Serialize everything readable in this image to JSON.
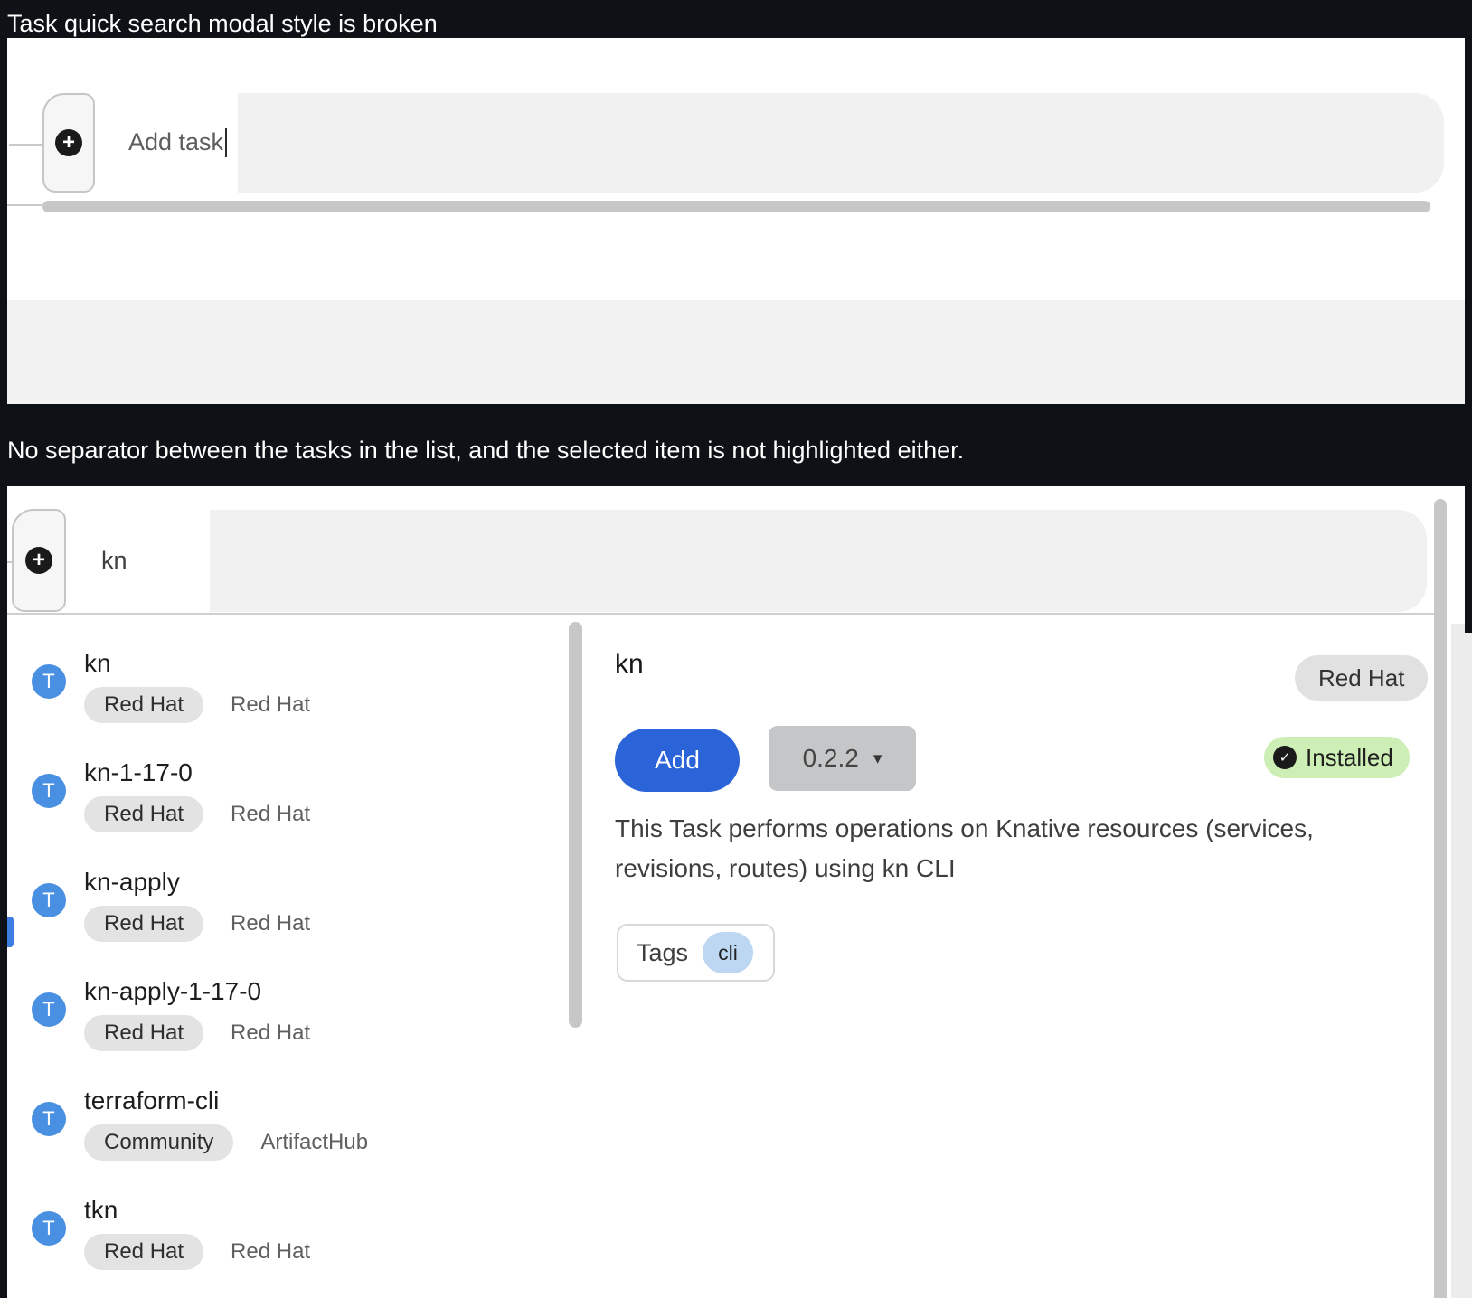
{
  "captions": {
    "first": "Task quick search modal style is broken",
    "second": "No separator between the tasks in the list, and the selected item is not highlighted either."
  },
  "icons": {
    "plus": "+",
    "check": "✓",
    "caret_down": "▾",
    "avatar_letter": "T"
  },
  "panel1": {
    "search_placeholder": "Add task"
  },
  "panel2": {
    "search_value": "kn",
    "list": [
      {
        "initial": "T",
        "name": "kn",
        "badge": "Red Hat",
        "source": "Red Hat"
      },
      {
        "initial": "T",
        "name": "kn-1-17-0",
        "badge": "Red Hat",
        "source": "Red Hat"
      },
      {
        "initial": "T",
        "name": "kn-apply",
        "badge": "Red Hat",
        "source": "Red Hat"
      },
      {
        "initial": "T",
        "name": "kn-apply-1-17-0",
        "badge": "Red Hat",
        "source": "Red Hat"
      },
      {
        "initial": "T",
        "name": "terraform-cli",
        "badge": "Community",
        "source": "ArtifactHub"
      },
      {
        "initial": "T",
        "name": "tkn",
        "badge": "Red Hat",
        "source": "Red Hat"
      }
    ],
    "detail": {
      "title": "kn",
      "provider_badge": "Red Hat",
      "add_button": "Add",
      "version": "0.2.2",
      "installed_label": "Installed",
      "description": "This Task performs operations on Knative resources (services, revisions, routes) using kn CLI",
      "tags_label": "Tags",
      "tags": [
        "cli"
      ]
    }
  },
  "colors": {
    "page_background": "#0e1116",
    "primary_blue": "#2b63d8",
    "avatar_blue": "#4a90e2",
    "installed_green": "#cdeeb4",
    "tag_chip_blue": "#bdd7f2",
    "pill_gray": "#e3e3e4",
    "searchbar_gray": "#f1f1f2",
    "scrollbar_gray": "#c7c7c7"
  }
}
